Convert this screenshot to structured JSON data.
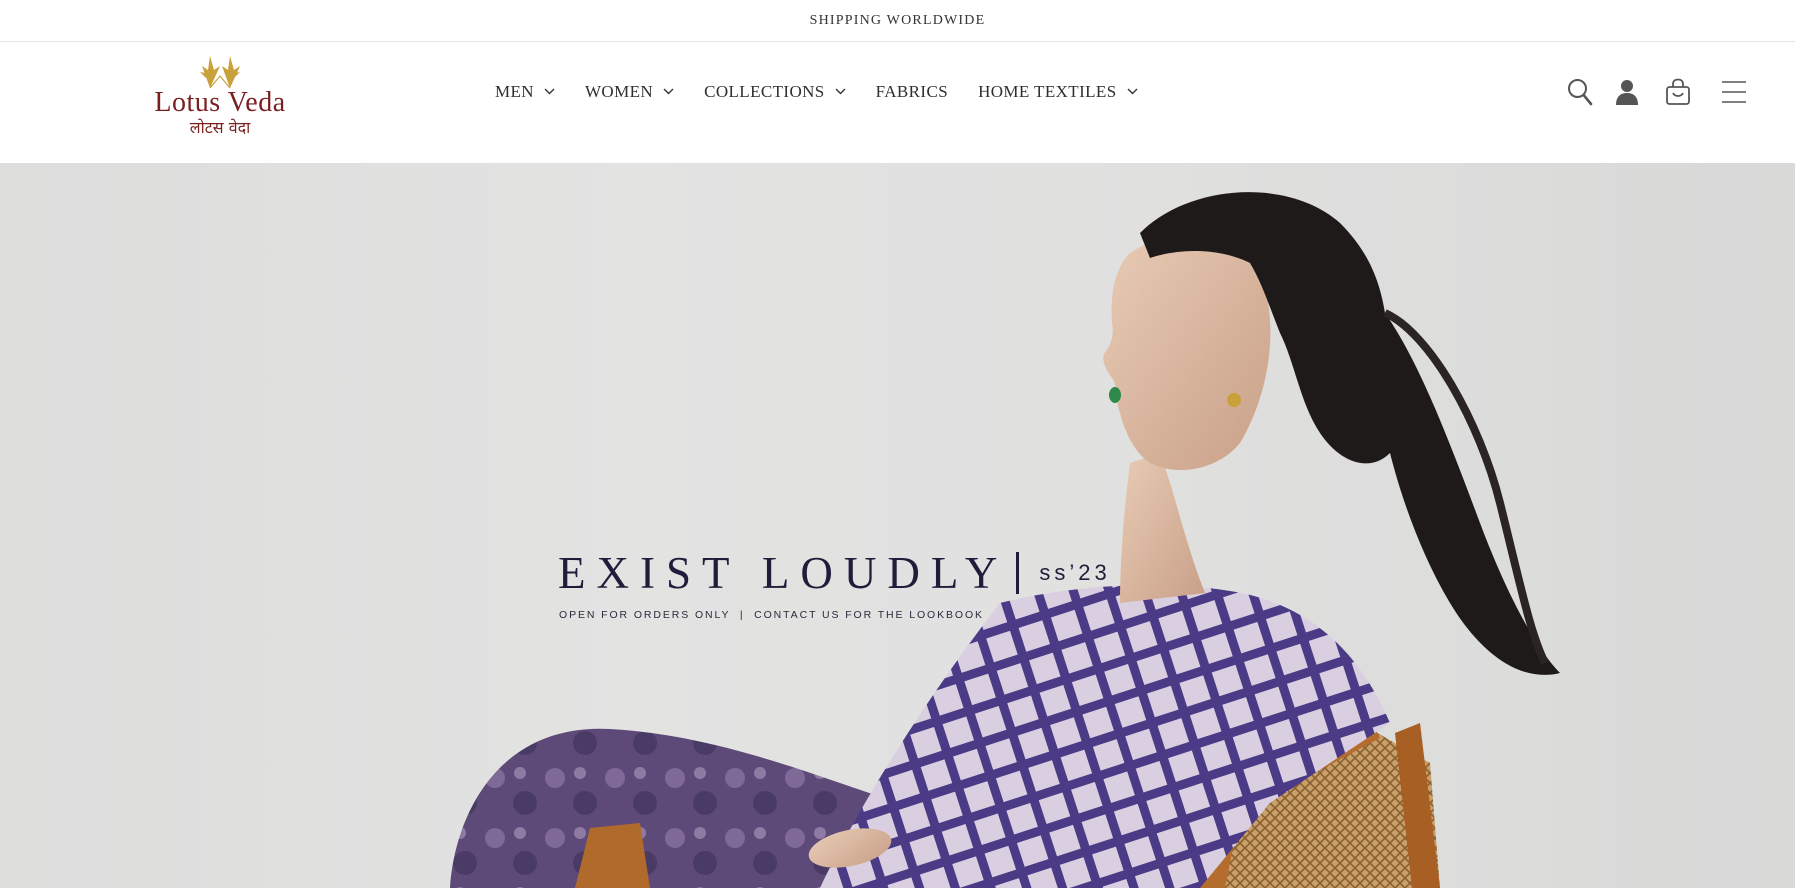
{
  "announcement": {
    "text": "SHIPPING WORLDWIDE"
  },
  "logo": {
    "name_en": "Lotus Veda",
    "name_hi": "लोटस वेदा"
  },
  "nav": {
    "items": [
      {
        "label": "MEN",
        "has_dropdown": true
      },
      {
        "label": "WOMEN",
        "has_dropdown": true
      },
      {
        "label": "COLLECTIONS",
        "has_dropdown": true
      },
      {
        "label": "FABRICS",
        "has_dropdown": false
      },
      {
        "label": "HOME TEXTILES",
        "has_dropdown": true
      }
    ]
  },
  "header_icons": [
    "search-icon",
    "account-icon",
    "cart-icon",
    "menu-icon"
  ],
  "hero": {
    "title": "EXIST LOUDLY",
    "season": "ss’23",
    "subtitle": "OPEN FOR ORDERS ONLY  |  CONTACT US FOR THE LOOKBOOK"
  },
  "colors": {
    "brand_maroon": "#7a1f1f",
    "logo_gold": "#c9a13a",
    "hero_text": "#1f1d3a",
    "hero_bg": "#e1e1e0"
  }
}
